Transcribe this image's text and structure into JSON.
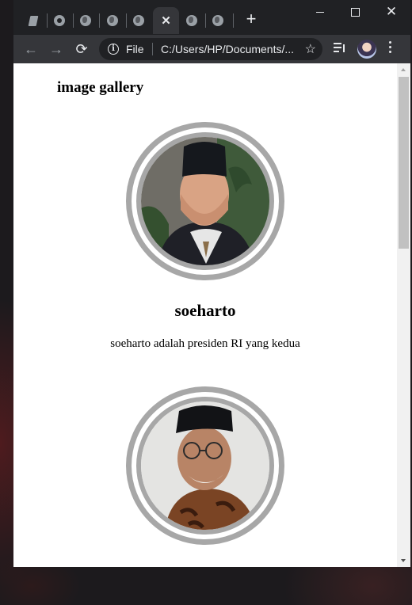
{
  "browser": {
    "tabs": [
      {
        "icon": "document-icon"
      },
      {
        "icon": "github-icon"
      },
      {
        "icon": "globe-icon"
      },
      {
        "icon": "globe-icon"
      },
      {
        "icon": "globe-icon"
      },
      {
        "icon": "close-icon",
        "active": true
      },
      {
        "icon": "globe-icon"
      },
      {
        "icon": "globe-icon"
      }
    ],
    "new_tab_label": "+",
    "address": {
      "scheme_label": "File",
      "url": "C:/Users/HP/Documents/..."
    }
  },
  "page": {
    "title": "image gallery",
    "items": [
      {
        "name": "soeharto",
        "description": "soeharto adalah presiden RI yang kedua"
      },
      {
        "name": "",
        "description": ""
      }
    ]
  },
  "colors": {
    "ring": "#a7a7a7",
    "browser_dark": "#202124",
    "toolbar": "#35363a"
  }
}
